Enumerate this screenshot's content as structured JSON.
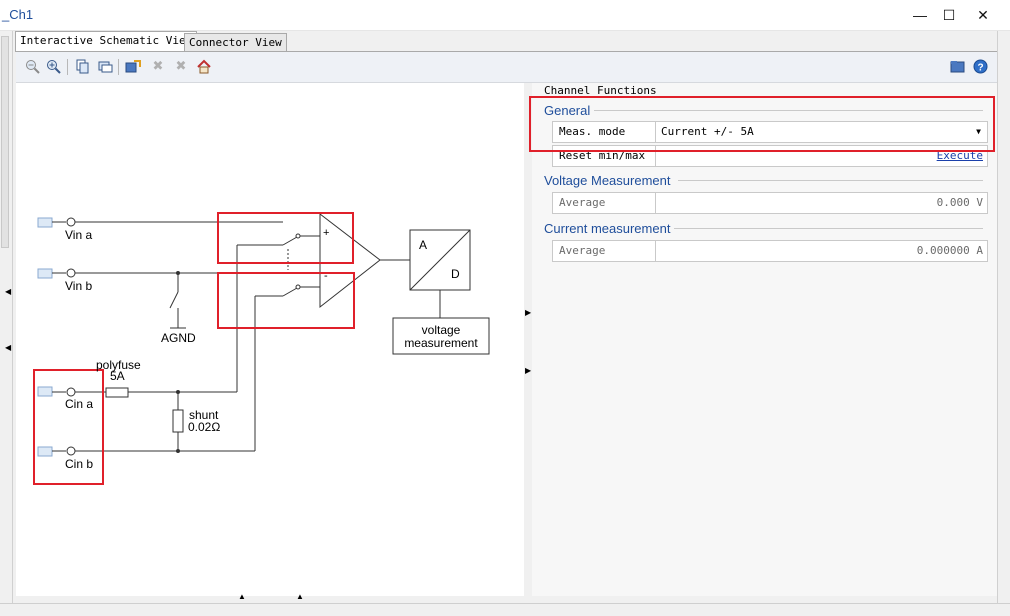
{
  "window": {
    "title": "_Ch1",
    "minimize_glyph": "—",
    "maximize_glyph": "☐",
    "close_glyph": "✕"
  },
  "tabs": [
    {
      "label": "Interactive Schematic View"
    },
    {
      "label": "Connector View"
    }
  ],
  "toolbar": {
    "icons": [
      "zoom-out-icon",
      "zoom-in-icon",
      "copy-icon",
      "paste-icon",
      "export-icon",
      "delete-icon",
      "clear-icon",
      "home-icon",
      "folder-icon",
      "help-icon"
    ]
  },
  "schematic": {
    "inputs": [
      "Vin a",
      "Vin b",
      "Cin a",
      "Cin b"
    ],
    "agnd_label": "AGND",
    "polyfuse_label": "polyfuse",
    "polyfuse_rating": "5A",
    "shunt_label": "shunt",
    "shunt_value": "0.02Ω",
    "opamp_plus": "+",
    "opamp_minus": "-",
    "adc_a": "A",
    "adc_d": "D",
    "voltage_measurement_line1": "voltage",
    "voltage_measurement_line2": "measurement"
  },
  "panel": {
    "header": "Channel Functions",
    "general": {
      "title": "General",
      "meas_mode_label": "Meas. mode",
      "meas_mode_value": "Current +/- 5A",
      "reset_label": "Reset min/max",
      "reset_action": "Execute"
    },
    "voltage": {
      "title": "Voltage Measurement",
      "average_label": "Average",
      "average_value": "0.000 V"
    },
    "current": {
      "title": "Current measurement",
      "average_label": "Average",
      "average_value": "0.000000 A"
    }
  },
  "colors": {
    "accent": "#1f4e9b",
    "highlight": "#e0202a",
    "link": "#1a3faa"
  }
}
